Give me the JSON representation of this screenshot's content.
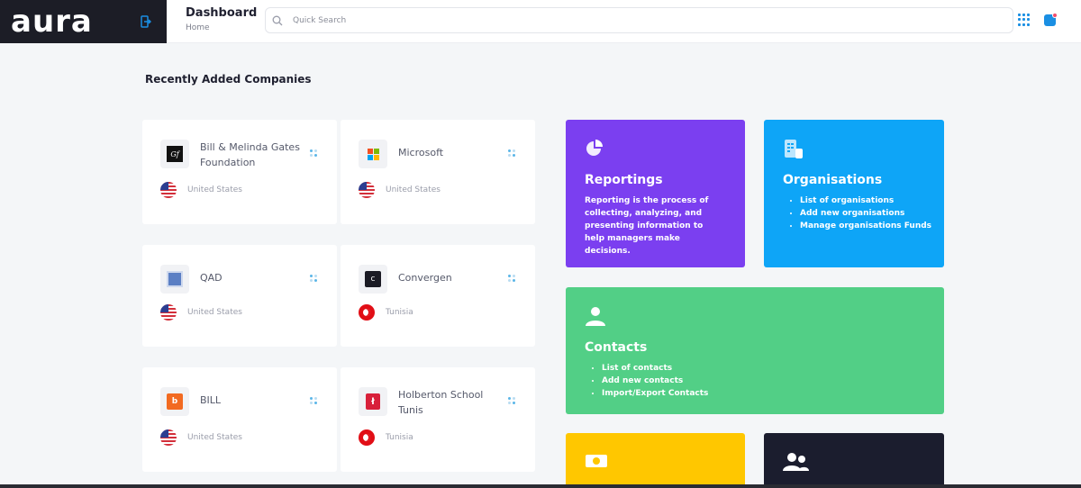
{
  "app": {
    "logo": "aura",
    "page_title": "Dashboard",
    "breadcrumb": "Home"
  },
  "search": {
    "placeholder": "Quick Search",
    "value": ""
  },
  "section": {
    "title": "Recently Added Companies"
  },
  "companies": [
    {
      "name": "Bill & Melinda Gates Foundation",
      "country": "United States",
      "logo_icon": "gf-logo-icon",
      "flag": "us-flag-icon"
    },
    {
      "name": "Microsoft",
      "country": "United States",
      "logo_icon": "microsoft-logo-icon",
      "flag": "us-flag-icon"
    },
    {
      "name": "QAD",
      "country": "United States",
      "logo_icon": "qad-logo-icon",
      "flag": "us-flag-icon"
    },
    {
      "name": "Convergen",
      "country": "Tunisia",
      "logo_icon": "convergen-logo-icon",
      "flag": "tunisia-flag-icon"
    },
    {
      "name": "BILL",
      "country": "United States",
      "logo_icon": "bill-logo-icon",
      "flag": "us-flag-icon"
    },
    {
      "name": "Holberton School Tunis",
      "country": "Tunisia",
      "logo_icon": "holberton-logo-icon",
      "flag": "tunisia-flag-icon"
    }
  ],
  "tiles": {
    "reportings": {
      "title": "Reportings",
      "description": "Reporting is the process of collecting, analyzing, and presenting information to help managers make decisions.",
      "color": "#7b3ff0",
      "icon": "pie-chart-icon"
    },
    "organisations": {
      "title": "Organisations",
      "items": [
        "List of organisations",
        "Add new organisations",
        "Manage organisations Funds"
      ],
      "color": "#0ea5f7",
      "icon": "organisation-list-icon"
    },
    "contacts": {
      "title": "Contacts",
      "items": [
        "List of contacts",
        "Add new contacts",
        "Import/Export Contacts"
      ],
      "color": "#52cf86",
      "icon": "user-icon"
    },
    "funds": {
      "color": "#ffc700",
      "icon": "money-icon"
    },
    "users": {
      "color": "#1b1d2e",
      "icon": "users-icon"
    }
  },
  "colors": {
    "accent": "#1a8fe3",
    "sidebar_dark": "#1c1d26",
    "background": "#f4f6f8"
  }
}
